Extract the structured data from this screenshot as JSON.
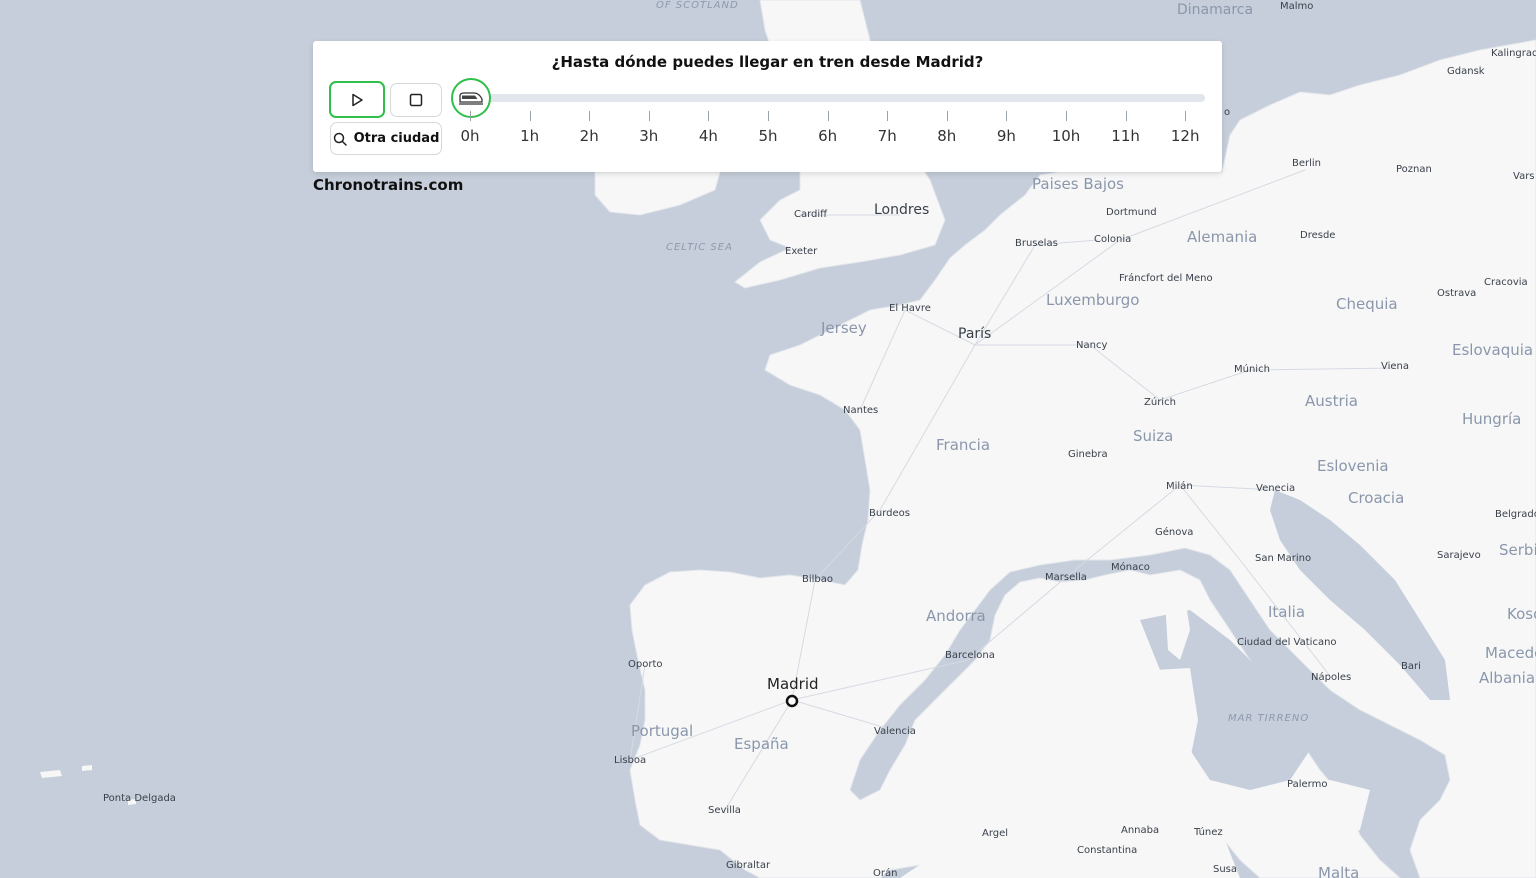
{
  "app": {
    "title": "¿Hasta dónde puedes llegar en tren desde Madrid?",
    "brand": "Chronotrains.com"
  },
  "controls": {
    "play_icon": "play-icon",
    "stop_icon": "stop-icon",
    "search_icon": "search-icon",
    "train_icon": "train-icon",
    "other_city_label": "Otra ciudad",
    "slider_value_hours": 0
  },
  "timeline": {
    "ticks": [
      "0h",
      "1h",
      "2h",
      "3h",
      "4h",
      "5h",
      "6h",
      "7h",
      "8h",
      "9h",
      "10h",
      "11h",
      "12h"
    ]
  },
  "colors": {
    "accent": "#2fbf4a",
    "sea": "#c5ceda",
    "land": "#f7f7f8"
  },
  "map": {
    "origin": "Madrid",
    "countries": [
      "Paises Bajos",
      "Alemania",
      "Luxemburgo",
      "Chequia",
      "Eslovaquia",
      "Austria",
      "Hungría",
      "Suiza",
      "Francia",
      "Eslovenia",
      "Croacia",
      "Serbia",
      "Kosovo",
      "Macedonia",
      "Albania",
      "Italia",
      "Andorra",
      "Portugal",
      "España",
      "Jersey",
      "Malta"
    ],
    "cities": [
      "Dinamarca",
      "Malmo",
      "Kalingrad",
      "Gdansk",
      "Berlin",
      "Poznan",
      "Vars",
      "Dortmund",
      "Colonia",
      "Dresde",
      "Bruselas",
      "Fráncfort del Meno",
      "Londres",
      "Cardiff",
      "Exeter",
      "El Havre",
      "París",
      "Nancy",
      "Cracovia",
      "Ostrava",
      "Viena",
      "Múnich",
      "Zúrich",
      "Nantes",
      "Ginebra",
      "Milán",
      "Venecia",
      "Burdeos",
      "Génova",
      "San Marino",
      "Belgrado",
      "Sarajevo",
      "Bilbao",
      "Marsella",
      "Mónaco",
      "Barcelona",
      "Ciudad del Vaticano",
      "Oporto",
      "Madrid",
      "Nápoles",
      "Bari",
      "Valencia",
      "Lisboa",
      "Sevilla",
      "Palermo",
      "Argel",
      "Annaba",
      "Túnez",
      "Constantina",
      "Gibraltar",
      "Orán",
      "Susa",
      "Ponta Delgada",
      "o"
    ],
    "seas": [
      "OF SCOTLAND",
      "CELTIC SEA",
      "MAR TIRRENO"
    ]
  }
}
